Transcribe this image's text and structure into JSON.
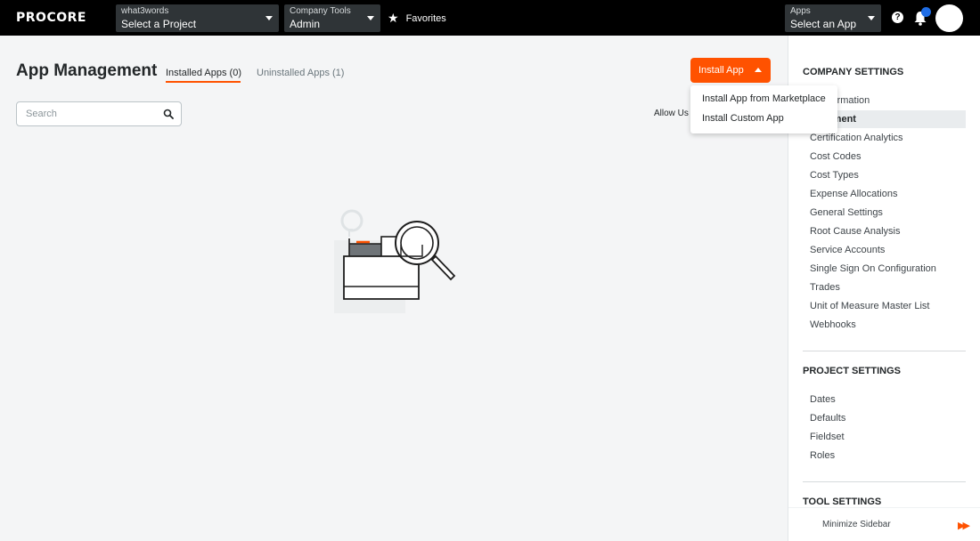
{
  "nav": {
    "logo": "PROCORE",
    "project": {
      "small": "what3words",
      "value": "Select a Project"
    },
    "tool": {
      "small": "Company Tools",
      "value": "Admin"
    },
    "favorites": "Favorites",
    "apps": {
      "small": "Apps",
      "value": "Select an App"
    },
    "help": "?"
  },
  "main": {
    "title": "App Management",
    "tabs": [
      {
        "label": "Installed Apps (0)",
        "active": true
      },
      {
        "label": "Uninstalled Apps (1)",
        "active": false
      }
    ],
    "search_placeholder": "Search",
    "allow_text": "Allow Us",
    "install_button": "Install App",
    "install_menu": [
      "Install App from Marketplace",
      "Install Custom App"
    ]
  },
  "sidebar": {
    "company_heading": "COMPANY SETTINGS",
    "company_items": [
      "nt Information",
      "nagement",
      "Certification Analytics",
      "Cost Codes",
      "Cost Types",
      "Expense Allocations",
      "General Settings",
      "Root Cause Analysis",
      "Service Accounts",
      "Single Sign On Configuration",
      "Trades",
      "Unit of Measure Master List",
      "Webhooks"
    ],
    "project_heading": "PROJECT SETTINGS",
    "project_items": [
      "Dates",
      "Defaults",
      "Fieldset",
      "Roles"
    ],
    "tool_heading": "TOOL SETTINGS",
    "minimize": "Minimize Sidebar"
  },
  "colors": {
    "accent": "#ff5200",
    "nav_bg": "#000000",
    "notification": "#1f6de5"
  },
  "icons": [
    "star-icon",
    "help-icon",
    "bell-icon",
    "search-icon",
    "caret-down-icon",
    "caret-up-icon",
    "double-chevron-right-icon"
  ]
}
